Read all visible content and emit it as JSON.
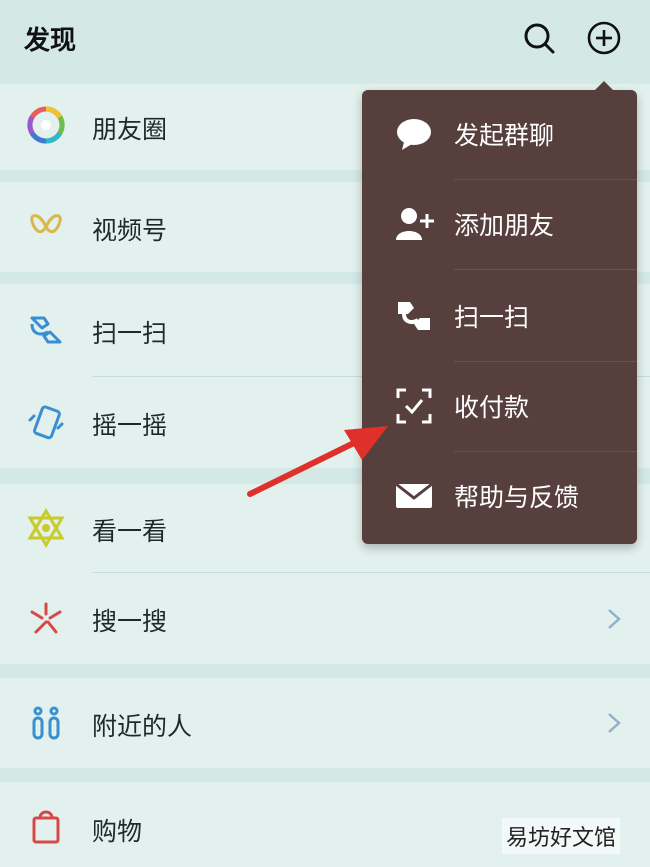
{
  "header": {
    "title": "发现"
  },
  "discover": {
    "moments": "朋友圈",
    "channels": "视频号",
    "scan": "扫一扫",
    "shake": "摇一摇",
    "top_stories": "看一看",
    "search": "搜一搜",
    "nearby": "附近的人",
    "shopping": "购物"
  },
  "menu": {
    "items": [
      {
        "label": "发起群聊",
        "icon": "chat-bubble-icon"
      },
      {
        "label": "添加朋友",
        "icon": "add-friend-icon"
      },
      {
        "label": "扫一扫",
        "icon": "scan-icon"
      },
      {
        "label": "收付款",
        "icon": "payment-icon"
      },
      {
        "label": "帮助与反馈",
        "icon": "mail-icon"
      }
    ]
  },
  "watermark": "易坊好文馆",
  "colors": {
    "background": "#d4e9e6",
    "menu_bg": "#563f3c",
    "arrow": "#e0302b"
  }
}
